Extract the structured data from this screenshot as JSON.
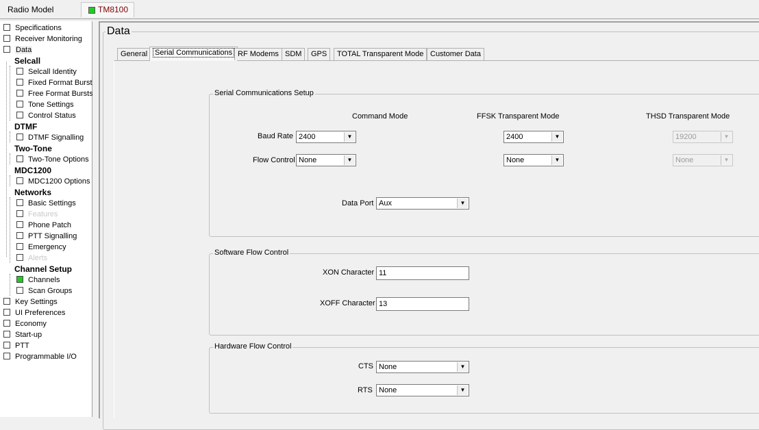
{
  "topbar": {
    "radio_model_label": "Radio Model",
    "radio_tab": "TM8100"
  },
  "sidebar": {
    "specifications": "Specifications",
    "receiver_monitoring": "Receiver Monitoring",
    "data": "Data",
    "selcall": "Selcall",
    "selcall_identity": "Selcall Identity",
    "fixed_format_bursts": "Fixed Format Bursts",
    "free_format_bursts": "Free Format Bursts",
    "tone_settings": "Tone Settings",
    "control_status": "Control Status",
    "dtmf": "DTMF",
    "dtmf_signalling": "DTMF Signalling",
    "two_tone": "Two-Tone",
    "two_tone_options": "Two-Tone Options",
    "mdc1200": "MDC1200",
    "mdc1200_options": "MDC1200 Options",
    "networks": "Networks",
    "basic_settings": "Basic Settings",
    "features": "Features",
    "phone_patch": "Phone Patch",
    "ptt_signalling": "PTT Signalling",
    "emergency": "Emergency",
    "alerts": "Alerts",
    "channel_setup": "Channel Setup",
    "channels": "Channels",
    "scan_groups": "Scan Groups",
    "key_settings": "Key Settings",
    "ui_preferences": "UI Preferences",
    "economy": "Economy",
    "startup": "Start-up",
    "ptt": "PTT",
    "programmable_io": "Programmable I/O"
  },
  "main": {
    "title": "Data",
    "tabs": [
      "General",
      "Serial Communications",
      "RF Modems",
      "SDM",
      "GPS",
      "TOTAL Transparent Mode",
      "Customer Data"
    ],
    "serial_setup": {
      "legend": "Serial Communications Setup",
      "col_command": "Command Mode",
      "col_ffsk": "FFSK Transparent Mode",
      "col_thsd": "THSD Transparent Mode",
      "baud_rate_label": "Baud Rate",
      "flow_control_label": "Flow Control",
      "cmd_baud": "2400",
      "cmd_flow": "None",
      "ffsk_baud": "2400",
      "ffsk_flow": "None",
      "thsd_baud": "19200",
      "thsd_flow": "None",
      "data_port_label": "Data Port",
      "data_port": "Aux"
    },
    "software_flow": {
      "legend": "Software Flow Control",
      "xon_label": "XON Character",
      "xon": "11",
      "xoff_label": "XOFF Character",
      "xoff": "13"
    },
    "hardware_flow": {
      "legend": "Hardware Flow Control",
      "cts_label": "CTS",
      "cts": "None",
      "rts_label": "RTS",
      "rts": "None"
    }
  }
}
